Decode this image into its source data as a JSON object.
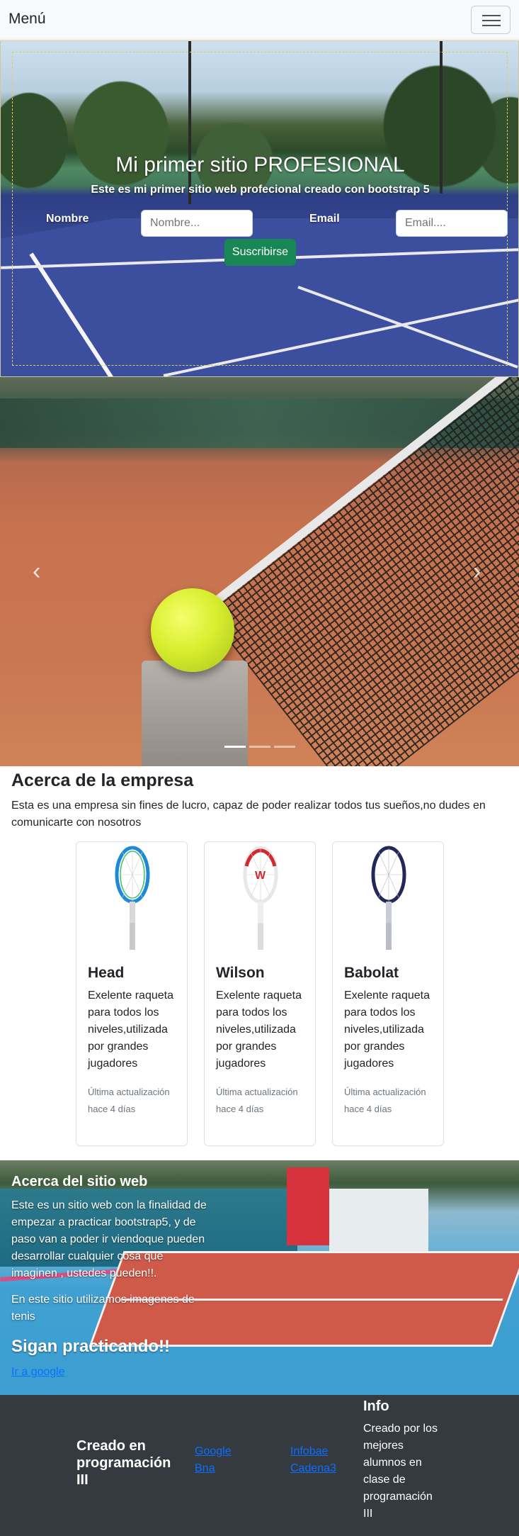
{
  "navbar": {
    "brand": "Menú",
    "toggler_icon": "hamburger-icon"
  },
  "hero": {
    "title": "Mi primer sitio PROFESIONAL",
    "subtitle": "Este es mi primer sitio web profecional creado con bootstrap 5",
    "name_label": "Nombre",
    "name_placeholder": "Nombre...",
    "email_label": "Email",
    "email_placeholder": "Email....",
    "subscribe_label": "Suscribirse"
  },
  "carousel": {
    "prev_icon": "chevron-left-icon",
    "next_icon": "chevron-right-icon",
    "prev_glyph": "‹",
    "next_glyph": "›",
    "slides": 3,
    "active_slide": 1
  },
  "about": {
    "title": "Acerca de la empresa",
    "text": "Esta es una empresa sin fines de lucro, capaz de poder realizar todos tus sueños,no dudes en comunicarte con nosotros"
  },
  "cards": [
    {
      "name": "Head",
      "text": "Exelente raqueta para todos los niveles,utilizada por grandes jugadores",
      "updated": "Última actualización hace 4 días",
      "color": "#1e8ad6"
    },
    {
      "name": "Wilson",
      "text": "Exelente raqueta para todos los niveles,utilizada por grandes jugadores",
      "updated": "Última actualización hace 4 días",
      "color": "#d12a35"
    },
    {
      "name": "Babolat",
      "text": "Exelente raqueta para todos los niveles,utilizada por grandes jugadores",
      "updated": "Última actualización hace 4 días",
      "color": "#23285a"
    }
  ],
  "feature": {
    "title": "Acerca del sitio web",
    "text1": "Este es un sitio web con la finalidad de empezar a practicar bootstrap5, y de paso van a poder ir viendoque pueden desarrollar cualquier cosa que imaginen , ustedes pueden!!.",
    "text2": "En este sitio utilizamos imagenes de tenis",
    "heading": "Sigan practicando!!",
    "link": "Ir a google"
  },
  "footer": {
    "title": "Creado en programación III",
    "links1": [
      "Google",
      "Bna"
    ],
    "links2": [
      "Infobae",
      "Cadena3"
    ],
    "info_title": "Info",
    "info_text": "Creado por los mejores alumnos en clase de programación III"
  },
  "colors": {
    "success": "#198754",
    "link": "#0d6efd",
    "footer_bg": "#343a40",
    "navbar_bg": "#f8f9fa"
  }
}
